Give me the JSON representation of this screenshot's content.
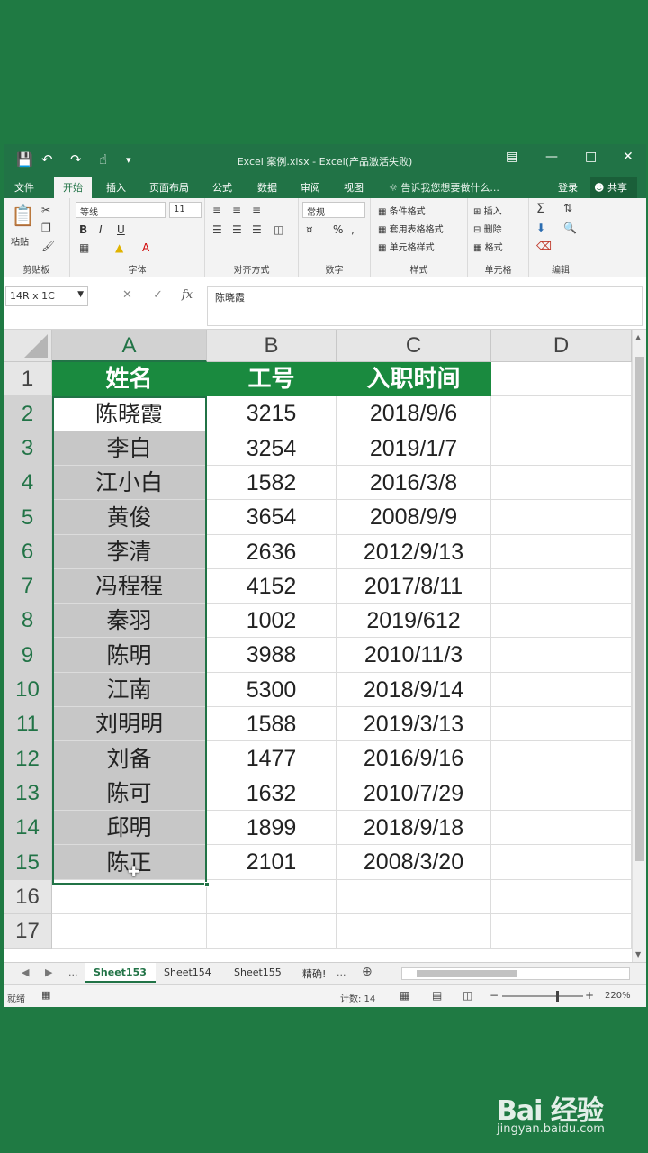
{
  "window": {
    "title": "Excel 案例.xlsx - Excel(产品激活失败)"
  },
  "menu": {
    "tabs": [
      "文件",
      "开始",
      "插入",
      "页面布局",
      "公式",
      "数据",
      "审阅",
      "视图"
    ],
    "active_tab": "开始",
    "tell_me": "告诉我您想要做什么...",
    "login": "登录",
    "share": "共享"
  },
  "ribbon": {
    "clipboard": {
      "label": "剪贴板",
      "paste": "粘贴"
    },
    "font": {
      "label": "字体",
      "font_name": "等线",
      "font_size": "11",
      "bold": "B",
      "italic": "I",
      "underline": "U"
    },
    "alignment": {
      "label": "对齐方式"
    },
    "number": {
      "label": "数字",
      "format": "常规",
      "percent": "%"
    },
    "styles": {
      "label": "样式",
      "conditional": "条件格式",
      "table": "套用表格格式",
      "cell_styles": "单元格样式"
    },
    "cells": {
      "label": "单元格",
      "insert": "插入",
      "delete": "删除",
      "format": "格式"
    },
    "editing": {
      "label": "编辑"
    }
  },
  "formula_bar": {
    "name_box": "14R x 1C",
    "content": "陈晓霞"
  },
  "grid": {
    "columns": [
      "A",
      "B",
      "C",
      "D"
    ],
    "rows": [
      "1",
      "2",
      "3",
      "4",
      "5",
      "6",
      "7",
      "8",
      "9",
      "10",
      "11",
      "12",
      "13",
      "14",
      "15",
      "16",
      "17"
    ],
    "header": [
      "姓名",
      "工号",
      "入职时间"
    ],
    "data": [
      [
        "陈晓霞",
        "3215",
        "2018/9/6"
      ],
      [
        "李白",
        "3254",
        "2019/1/7"
      ],
      [
        "江小白",
        "1582",
        "2016/3/8"
      ],
      [
        "黄俊",
        "3654",
        "2008/9/9"
      ],
      [
        "李清",
        "2636",
        "2012/9/13"
      ],
      [
        "冯程程",
        "4152",
        "2017/8/11"
      ],
      [
        "秦羽",
        "1002",
        "2019/612"
      ],
      [
        "陈明",
        "3988",
        "2010/11/3"
      ],
      [
        "江南",
        "5300",
        "2018/9/14"
      ],
      [
        "刘明明",
        "1588",
        "2019/3/13"
      ],
      [
        "刘备",
        "1477",
        "2016/9/16"
      ],
      [
        "陈可",
        "1632",
        "2010/7/29"
      ],
      [
        "邱明",
        "1899",
        "2018/9/18"
      ],
      [
        "陈正",
        "2101",
        "2008/3/20"
      ]
    ]
  },
  "sheets": {
    "tabs": [
      "Sheet153",
      "Sheet154",
      "Sheet155",
      "精确!"
    ],
    "active": "Sheet153",
    "ellipsis": "..."
  },
  "status": {
    "ready": "就绪",
    "count": "计数: 14",
    "zoom": "220%"
  },
  "watermark": {
    "logo": "Bai 经验",
    "url": "jingyan.baidu.com"
  },
  "colors": {
    "excel_green": "#217346",
    "header_fill": "#1a8a3f",
    "selection_fill": "#c7c7c7"
  }
}
